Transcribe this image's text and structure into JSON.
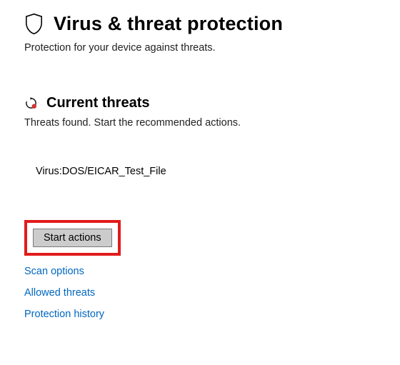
{
  "header": {
    "title": "Virus & threat protection",
    "subtitle": "Protection for your device against threats."
  },
  "currentThreats": {
    "heading": "Current threats",
    "status": "Threats found. Start the recommended actions.",
    "items": [
      {
        "name": "Virus:DOS/EICAR_Test_File"
      }
    ],
    "startButton": "Start actions"
  },
  "links": {
    "scanOptions": "Scan options",
    "allowedThreats": "Allowed threats",
    "protectionHistory": "Protection history"
  },
  "icons": {
    "shield": "shield-icon",
    "refresh": "refresh-alert-icon"
  }
}
